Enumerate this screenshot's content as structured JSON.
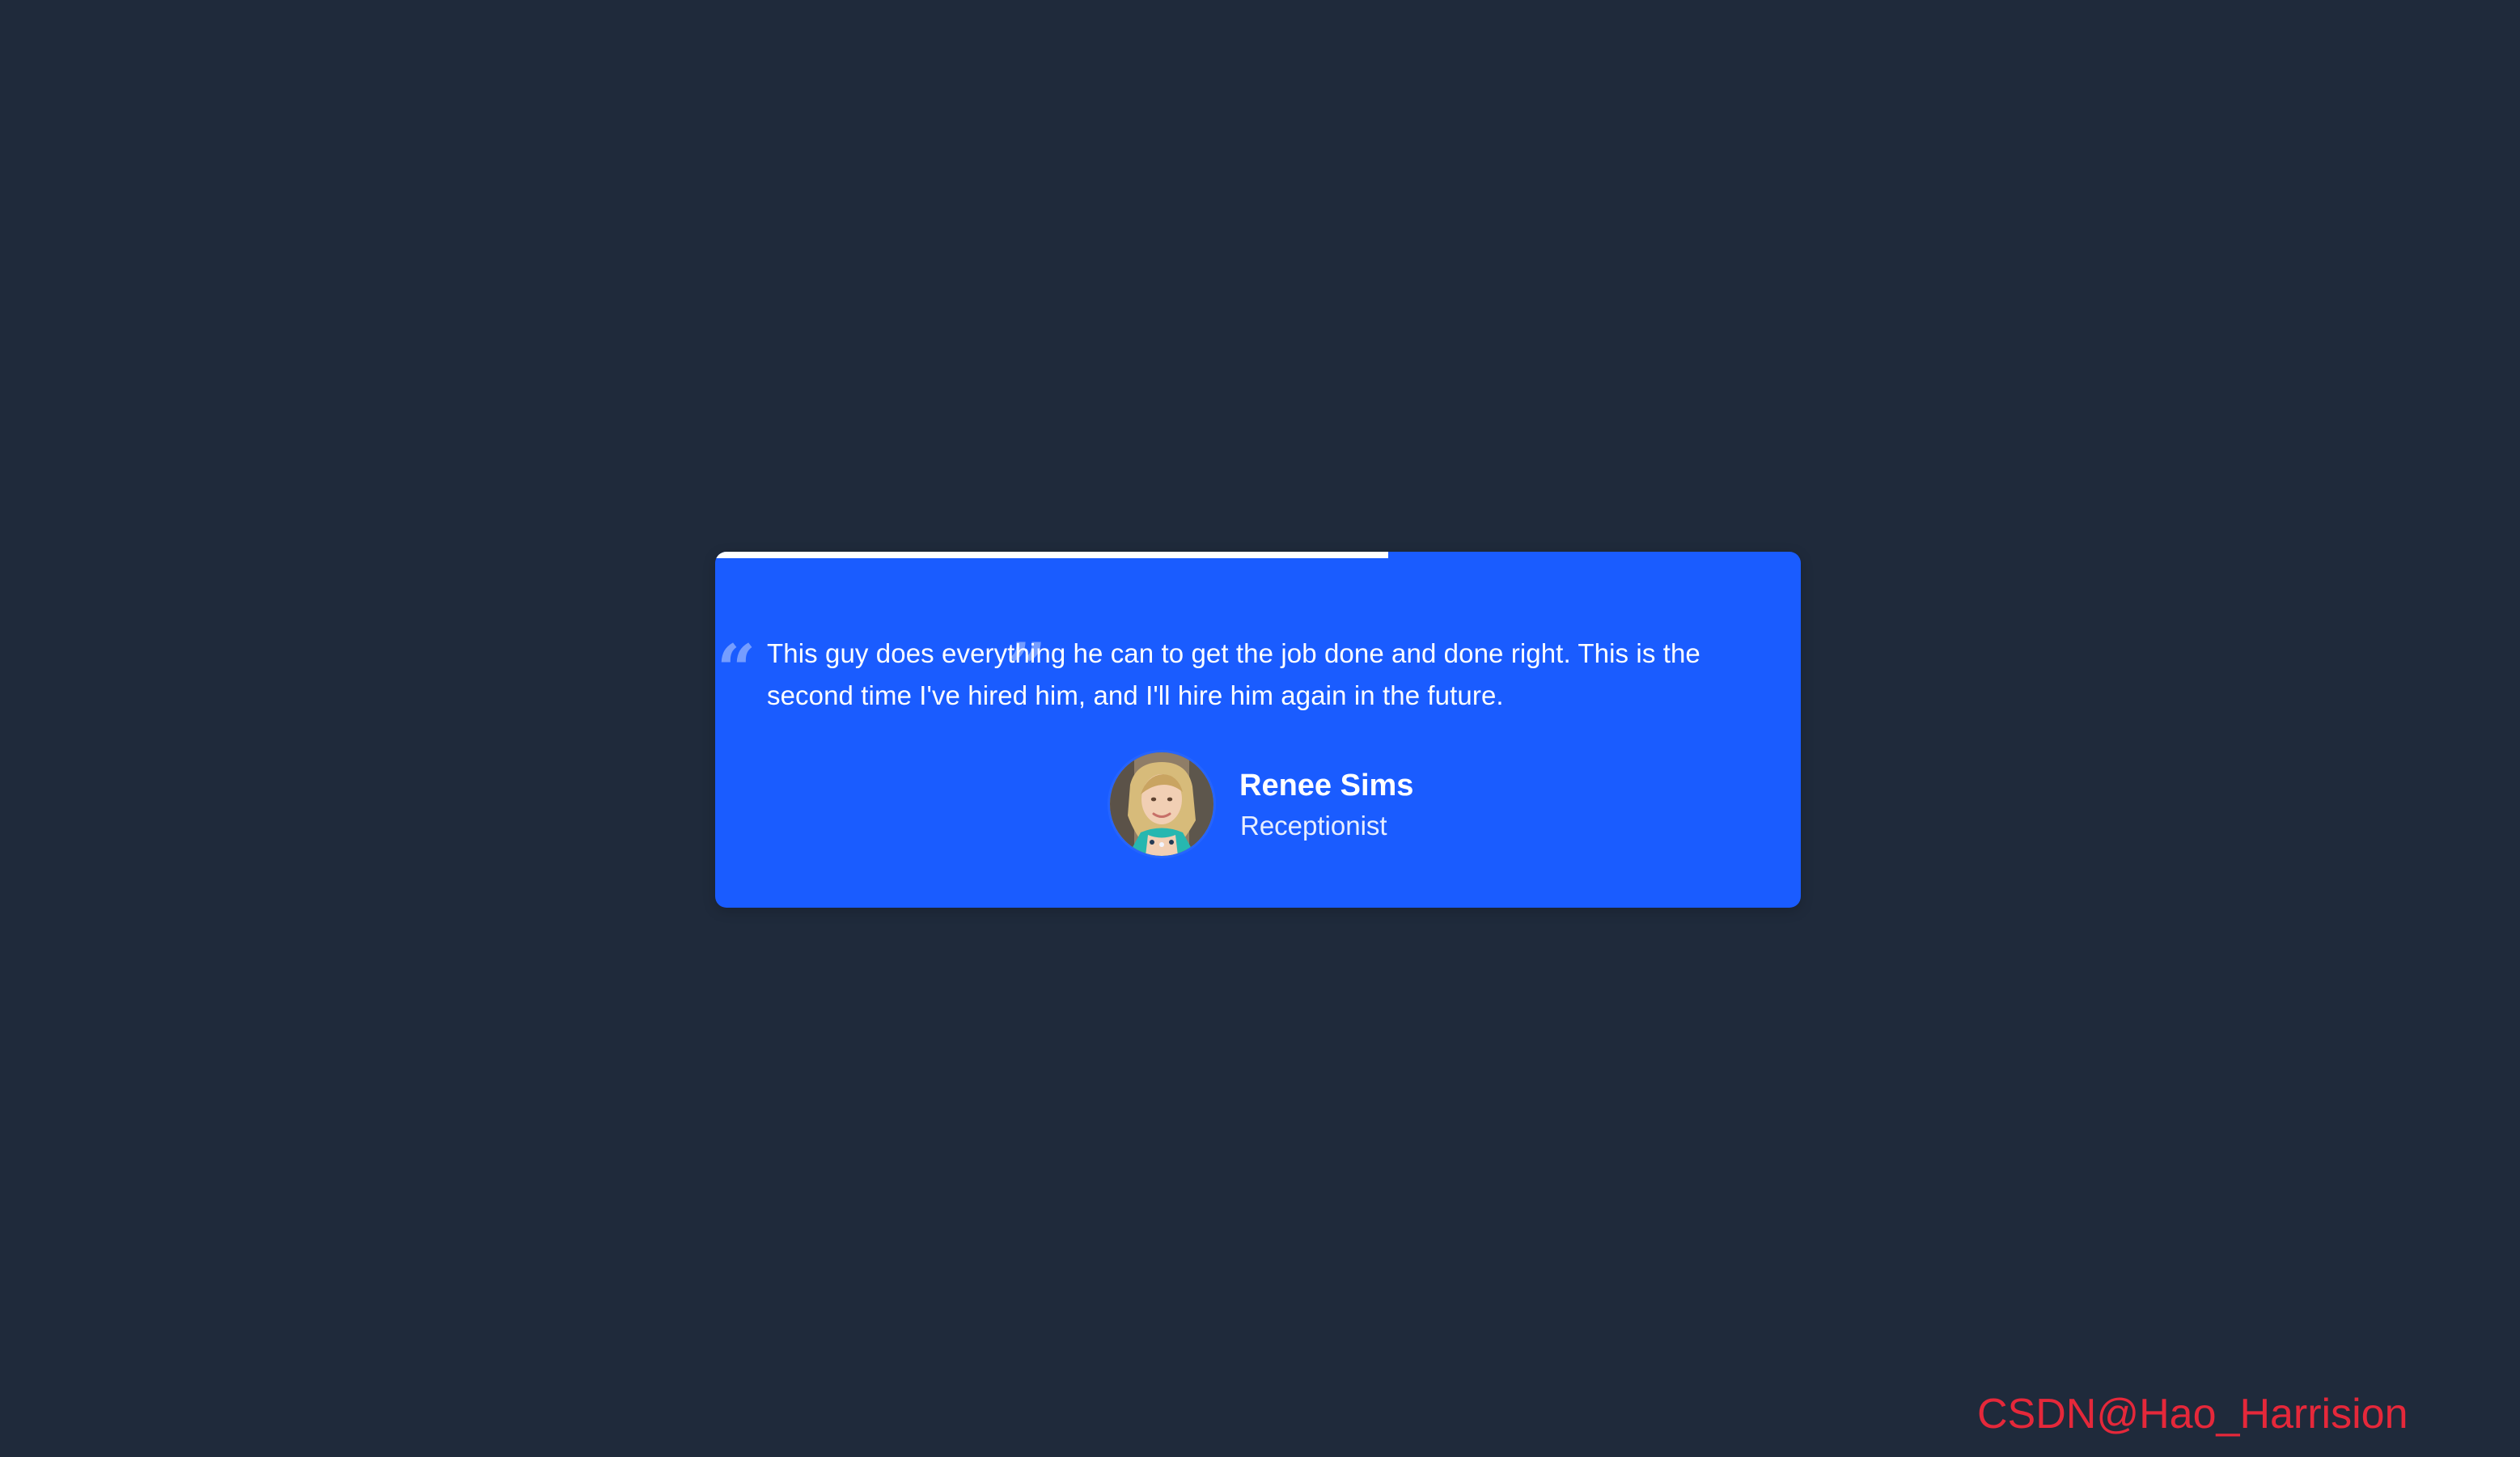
{
  "testimonial": {
    "progress_percent": 62,
    "quote": "This guy does everything he can to get the job done and done right. This is the second time I've hired him, and I'll hire him again in the future.",
    "author": {
      "name": "Renee Sims",
      "role": "Receptionist",
      "avatar_icon": "woman-portrait-avatar"
    },
    "quote_open_icon": "quote-open-icon",
    "quote_close_icon": "quote-close-icon"
  },
  "watermark": "CSDN@Hao_Harrision",
  "colors": {
    "page_background": "#1f2a3b",
    "card_background": "#1a5cff",
    "progress_fill": "#ffffff",
    "quote_marks": "#86a9ff",
    "watermark": "#e5283a"
  }
}
